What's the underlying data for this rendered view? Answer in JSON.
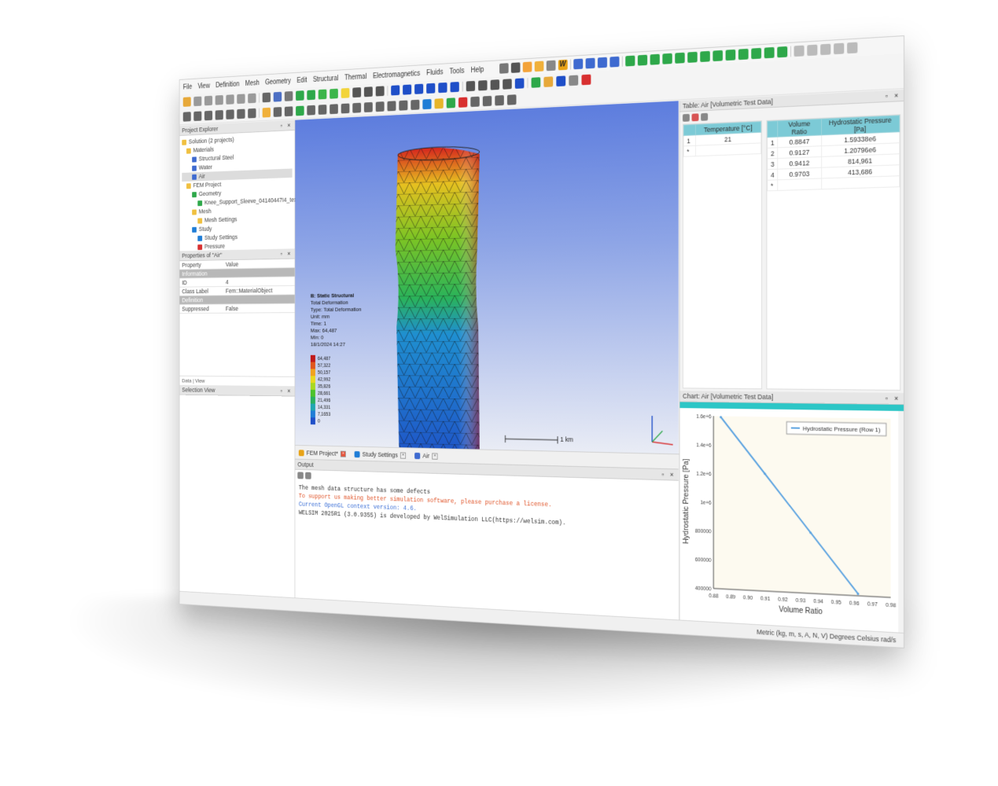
{
  "menu": [
    "File",
    "View",
    "Definition",
    "Mesh",
    "Geometry",
    "Edit",
    "Structural",
    "Thermal",
    "Electromagnetics",
    "Fluids",
    "Tools",
    "Help"
  ],
  "project_explorer": {
    "title": "Project Explorer",
    "items": [
      {
        "label": "Solution (2 projects)",
        "depth": 0
      },
      {
        "label": "Materials",
        "depth": 1
      },
      {
        "label": "Structural Steel",
        "depth": 2
      },
      {
        "label": "Water",
        "depth": 2
      },
      {
        "label": "Air",
        "depth": 2,
        "selected": true
      },
      {
        "label": "FEM Project",
        "depth": 1
      },
      {
        "label": "Geometry",
        "depth": 2
      },
      {
        "label": "Knee_Support_Sleeve_04140447I4_texture",
        "depth": 3
      },
      {
        "label": "Mesh",
        "depth": 2
      },
      {
        "label": "Mesh Settings",
        "depth": 3
      },
      {
        "label": "Study",
        "depth": 2
      },
      {
        "label": "Study Settings",
        "depth": 3
      },
      {
        "label": "Pressure",
        "depth": 3
      }
    ]
  },
  "properties": {
    "title": "Properties of \"Air\"",
    "header": {
      "property": "Property",
      "value": "Value"
    },
    "rows": [
      {
        "group": "Information"
      },
      {
        "property": "ID",
        "value": "4"
      },
      {
        "property": "Class Label",
        "value": "Fem::MaterialObject"
      },
      {
        "group": "Definition"
      },
      {
        "property": "Suppressed",
        "value": "False"
      }
    ],
    "tabs": [
      "Data",
      "View"
    ]
  },
  "selection_view": {
    "title": "Selection View"
  },
  "viewport": {
    "legend_title": "B: Static Structural",
    "legend_lines": [
      "Total Deformation",
      "Type: Total Deformation",
      "Unit: mm",
      "Time: 1",
      "Max: 64,487",
      "Min: 0",
      "18/1/2024 14:27"
    ],
    "legend_values": [
      "64,487",
      "57,322",
      "50,157",
      "42,992",
      "35,826",
      "28,661",
      "21,496",
      "14,331",
      "7,1653",
      "0"
    ],
    "legend_colors": [
      "#c0181a",
      "#e0561c",
      "#f0a21e",
      "#e8d820",
      "#a8d822",
      "#4cc22c",
      "#2ab060",
      "#1fa6b0",
      "#1f7dd6",
      "#1f4fc8"
    ],
    "scale_label": "1 km"
  },
  "doc_tabs": [
    "FEM Project*",
    "Study Settings",
    "Air"
  ],
  "output": {
    "title": "Output",
    "lines": [
      {
        "text": "The mesh data structure has some defects",
        "color": "#333333"
      },
      {
        "text": "To support us making better simulation software, please purchase a license.",
        "color": "#e0552a"
      },
      {
        "text": "Current OpenGL context version: 4.6.",
        "color": "#3b6fd6"
      },
      {
        "text": "WELSIM 2025R1 (3.0.9355) is developed by WelSimulation LLC(https://welsim.com).",
        "color": "#333333"
      }
    ]
  },
  "table": {
    "title": "Table: Air [Volumetric Test Data]",
    "temp_header": "Temperature [°C]",
    "temp_rows": [
      {
        "idx": "1",
        "value": "21"
      },
      {
        "idx": "*",
        "value": ""
      }
    ],
    "headers": [
      "Volume Ratio",
      "Hydrostatic Pressure [Pa]"
    ],
    "rows": [
      {
        "idx": "1",
        "ratio": "0.8847",
        "pressure": "1.59338e6"
      },
      {
        "idx": "2",
        "ratio": "0.9127",
        "pressure": "1.20796e6"
      },
      {
        "idx": "3",
        "ratio": "0.9412",
        "pressure": "814,961"
      },
      {
        "idx": "4",
        "ratio": "0.9703",
        "pressure": "413,686"
      },
      {
        "idx": "*",
        "ratio": "",
        "pressure": ""
      }
    ]
  },
  "chart_panel": {
    "title": "Chart: Air [Volumetric Test Data]"
  },
  "chart_data": {
    "type": "line",
    "xlabel": "Volume Ratio",
    "ylabel": "Hydrostatic Pressure [Pa]",
    "x": [
      0.8847,
      0.9127,
      0.9412,
      0.9703
    ],
    "series": [
      {
        "name": "Hydrostatic Pressure (Row 1)",
        "values": [
          1593380,
          1207960,
          814961,
          413686
        ]
      }
    ],
    "xlim": [
      0.88,
      0.99
    ],
    "ylim": [
      400000,
      1600000
    ],
    "xticks": [
      "0.88",
      "0.89",
      "0.90",
      "0.91",
      "0.92",
      "0.93",
      "0.94",
      "0.95",
      "0.96",
      "0.97",
      "0.98"
    ],
    "yticks": [
      "400000",
      "600000",
      "800000",
      "1e+6",
      "1.2e+6",
      "1.4e+6",
      "1.6e+6"
    ],
    "line_color": "#5aa2e0",
    "legend_position": "top-right"
  },
  "status": "Metric (kg, m, s, A, N, V)  Degrees  Celsius  rad/s"
}
